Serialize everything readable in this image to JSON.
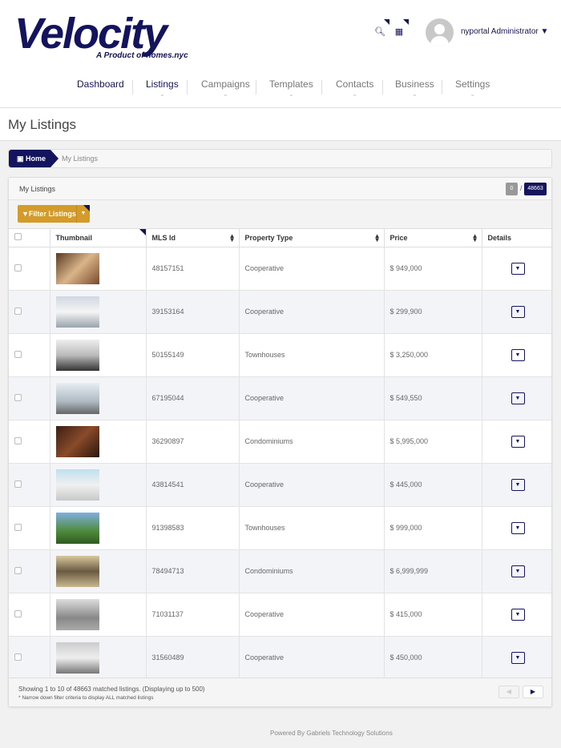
{
  "brand": {
    "name": "Velocity",
    "tagline": "A Product of homes.nyc"
  },
  "header": {
    "user": "nyportal Administrator",
    "icons": [
      "search-icon",
      "calendar-icon"
    ]
  },
  "nav": [
    {
      "label": "Dashboard"
    },
    {
      "label": "Listings"
    },
    {
      "label": "Campaigns"
    },
    {
      "label": "Templates"
    },
    {
      "label": "Contacts"
    },
    {
      "label": "Business"
    },
    {
      "label": "Settings"
    }
  ],
  "page_title": "My Listings",
  "breadcrumb": {
    "home": "Home",
    "current": "My Listings"
  },
  "panel": {
    "title": "My Listings",
    "selected": "0",
    "sep": "/",
    "total": "48663",
    "filter_label": "Filter Listings"
  },
  "columns": [
    "Thumbnail",
    "MLS Id",
    "Property Type",
    "Price",
    "Details"
  ],
  "rows": [
    {
      "mls": "48157151",
      "type": "Cooperative",
      "price": "$ 949,000"
    },
    {
      "mls": "39153164",
      "type": "Cooperative",
      "price": "$ 299,900"
    },
    {
      "mls": "50155149",
      "type": "Townhouses",
      "price": "$ 3,250,000"
    },
    {
      "mls": "67195044",
      "type": "Cooperative",
      "price": "$ 549,550"
    },
    {
      "mls": "36290897",
      "type": "Condominiums",
      "price": "$ 5,995,000"
    },
    {
      "mls": "43814541",
      "type": "Cooperative",
      "price": "$ 445,000"
    },
    {
      "mls": "91398583",
      "type": "Townhouses",
      "price": "$ 999,000"
    },
    {
      "mls": "78494713",
      "type": "Condominiums",
      "price": "$ 6,999,999"
    },
    {
      "mls": "71031137",
      "type": "Cooperative",
      "price": "$ 415,000"
    },
    {
      "mls": "31560489",
      "type": "Cooperative",
      "price": "$ 450,000"
    }
  ],
  "footer": {
    "showing": "Showing 1 to 10 of 48663 matched listings. (Displaying up to 500)",
    "note": "* Narrow down filter criteria to display ALL matched listings"
  },
  "powered_by": "Powered By Gabriels Technology Solutions",
  "colors": {
    "brand": "#14135e",
    "accent": "#d49a2a"
  }
}
